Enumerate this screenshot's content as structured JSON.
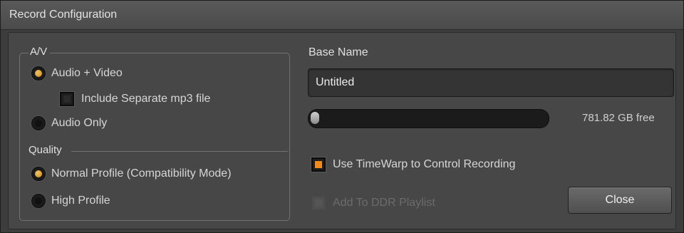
{
  "window": {
    "title": "Record Configuration"
  },
  "av_group": {
    "legend": "A/V",
    "options": [
      {
        "label": "Audio + Video",
        "selected": true
      },
      {
        "label": "Audio Only",
        "selected": false
      }
    ],
    "mp3_checkbox": {
      "label": "Include Separate mp3 file",
      "checked": false
    }
  },
  "quality_group": {
    "legend": "Quality",
    "options": [
      {
        "label": "Normal Profile (Compatibility Mode)",
        "selected": true
      },
      {
        "label": "High Profile",
        "selected": false
      }
    ]
  },
  "base_name": {
    "label": "Base Name",
    "value": "Untitled"
  },
  "disk": {
    "free_text": "781.82 GB free",
    "used_fraction": 0.03
  },
  "timewarp": {
    "label": "Use TimeWarp to Control Recording",
    "checked": true
  },
  "ddr_playlist": {
    "label": "Add To DDR Playlist",
    "checked": false,
    "enabled": false
  },
  "close_label": "Close",
  "colors": {
    "accent": "#f08a1c",
    "radio_selected": "#e0a43a"
  }
}
